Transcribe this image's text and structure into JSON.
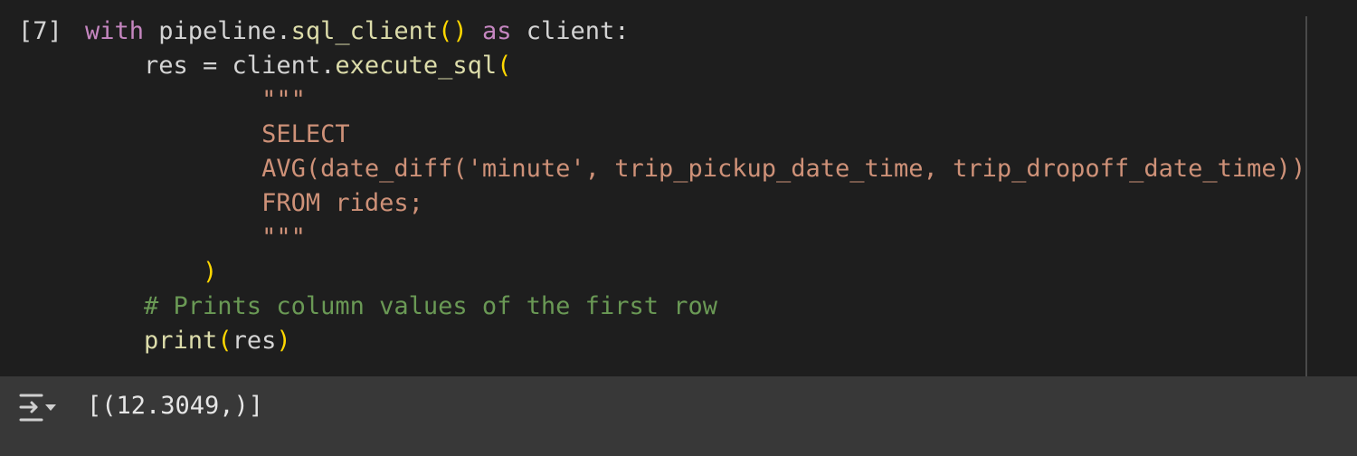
{
  "cell": {
    "execution_count": "[7]",
    "code_lines": [
      [
        {
          "t": "with",
          "c": "kw"
        },
        {
          "t": " pipeline.",
          "c": "plain"
        },
        {
          "t": "sql_client",
          "c": "fn"
        },
        {
          "t": "()",
          "c": "paren"
        },
        {
          "t": " ",
          "c": "plain"
        },
        {
          "t": "as",
          "c": "kw"
        },
        {
          "t": " client:",
          "c": "plain"
        }
      ],
      [
        {
          "t": "    res = client.",
          "c": "plain"
        },
        {
          "t": "execute_sql",
          "c": "fn"
        },
        {
          "t": "(",
          "c": "paren"
        }
      ],
      [
        {
          "t": "            \"\"\"",
          "c": "str"
        }
      ],
      [
        {
          "t": "            SELECT",
          "c": "str"
        }
      ],
      [
        {
          "t": "            AVG(date_diff('minute', trip_pickup_date_time, trip_dropoff_date_time))",
          "c": "str"
        }
      ],
      [
        {
          "t": "            FROM rides;",
          "c": "str"
        }
      ],
      [
        {
          "t": "            \"\"\"",
          "c": "str"
        }
      ],
      [
        {
          "t": "        ",
          "c": "plain"
        },
        {
          "t": ")",
          "c": "paren"
        }
      ],
      [
        {
          "t": "    # Prints column values of the first row",
          "c": "cmt"
        }
      ],
      [
        {
          "t": "    ",
          "c": "plain"
        },
        {
          "t": "print",
          "c": "fn"
        },
        {
          "t": "(",
          "c": "paren"
        },
        {
          "t": "res",
          "c": "plain"
        },
        {
          "t": ")",
          "c": "paren"
        }
      ]
    ],
    "output": {
      "icon": "output-expand-icon",
      "text": "[(12.3049,)]"
    }
  },
  "colors": {
    "keyword": "#c586c0",
    "function": "#dcdcaa",
    "paren": "#ffd700",
    "string": "#ce9178",
    "comment": "#6a9955",
    "text": "#d4d4d4",
    "background": "#1e1e1e",
    "output_background": "#383838"
  }
}
